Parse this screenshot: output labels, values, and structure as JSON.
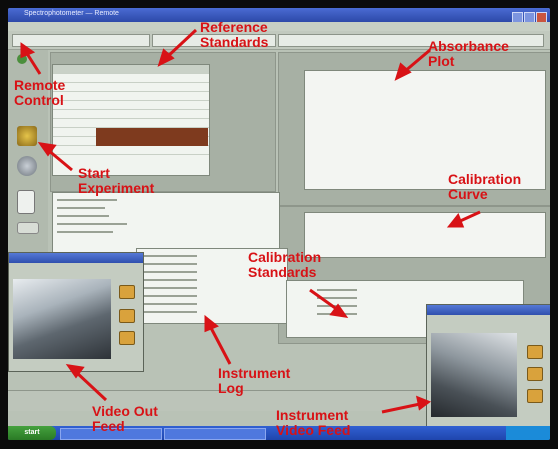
{
  "screen": {
    "window_title": "Spectrophotometer — Remote",
    "taskbar_start": "start"
  },
  "annotations": {
    "reference_standards": "Reference\nStandards",
    "absorbance_plot": "Absorbance\nPlot",
    "remote_control": "Remote\nControl",
    "start_experiment": "Start\nExperiment",
    "calibration_curve": "Calibration\nCurve",
    "calibration_standards": "Calibration\nStandards",
    "instrument_log": "Instrument\nLog",
    "video_out_feed": "Video Out\nFeed",
    "instrument_video_feed": "Instrument\nVideo Feed"
  },
  "colors": {
    "annotation": "#d81216",
    "highlight_row": "#7e3a1e",
    "titlebar": "#2d49a8"
  },
  "icons": [
    "remote-control-icon",
    "start-experiment-icon",
    "settings-icon",
    "document-icon"
  ]
}
